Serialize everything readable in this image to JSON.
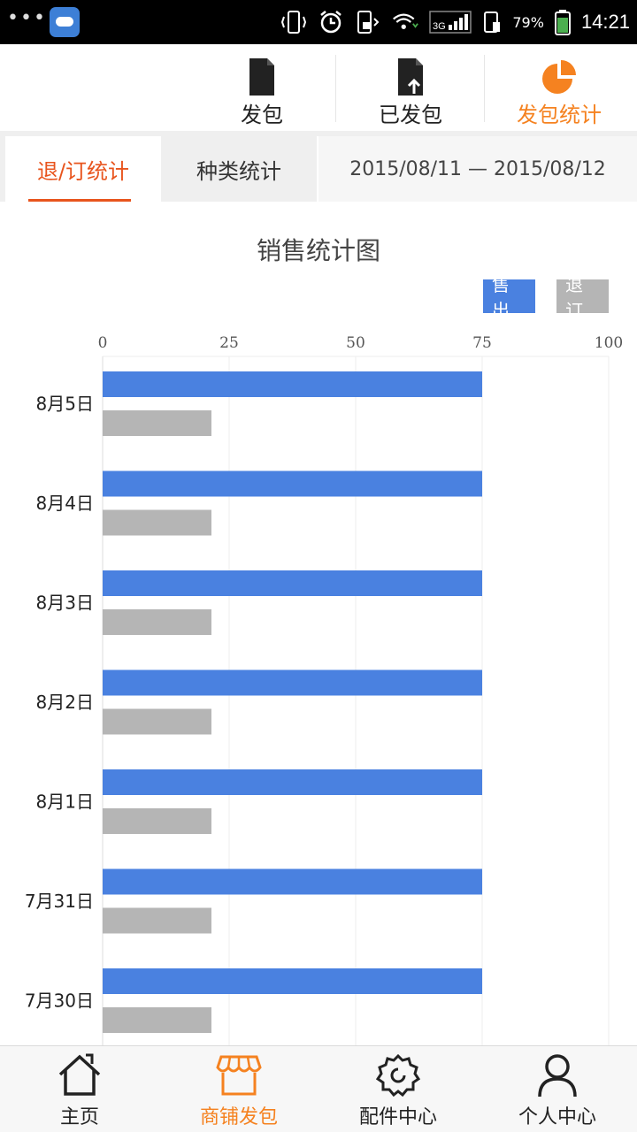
{
  "status_bar": {
    "dots": "•••",
    "battery_percent": "79%",
    "time": "14:21",
    "network": "3G"
  },
  "top_nav": {
    "items": [
      {
        "label": "发包",
        "icon": "document-icon"
      },
      {
        "label": "已发包",
        "icon": "document-upload-icon"
      },
      {
        "label": "发包统计",
        "icon": "pie-chart-icon",
        "active": true
      }
    ],
    "active_color": "#f58220"
  },
  "tabs": {
    "items": [
      {
        "label": "退/订统计",
        "active": true
      },
      {
        "label": "种类统计",
        "active": false
      }
    ],
    "date_range": "2015/08/11 — 2015/08/12",
    "active_color": "#e8541d"
  },
  "chart_data": {
    "type": "bar",
    "orientation": "horizontal",
    "title": "销售统计图",
    "categories": [
      "8月5日",
      "8月4日",
      "8月3日",
      "8月2日",
      "8月1日",
      "7月31日",
      "7月30日"
    ],
    "series": [
      {
        "name": "售出",
        "color": "#4a81e0",
        "values": [
          75,
          75,
          75,
          75,
          75,
          75,
          75
        ]
      },
      {
        "name": "退订",
        "color": "#b5b5b5",
        "values": [
          21.5,
          21.5,
          21.5,
          21.5,
          21.5,
          21.5,
          21.5
        ]
      }
    ],
    "xlim": [
      0,
      100
    ],
    "xticks": [
      0,
      25,
      50,
      75,
      100
    ],
    "axis_position": "top",
    "grid": true,
    "legend": "top-right"
  },
  "bottom_nav": {
    "items": [
      {
        "label": "主页",
        "icon": "home-icon"
      },
      {
        "label": "商铺发包",
        "icon": "shop-icon",
        "active": true
      },
      {
        "label": "配件中心",
        "icon": "gear-icon"
      },
      {
        "label": "个人中心",
        "icon": "person-icon"
      }
    ],
    "active_color": "#f58220"
  }
}
